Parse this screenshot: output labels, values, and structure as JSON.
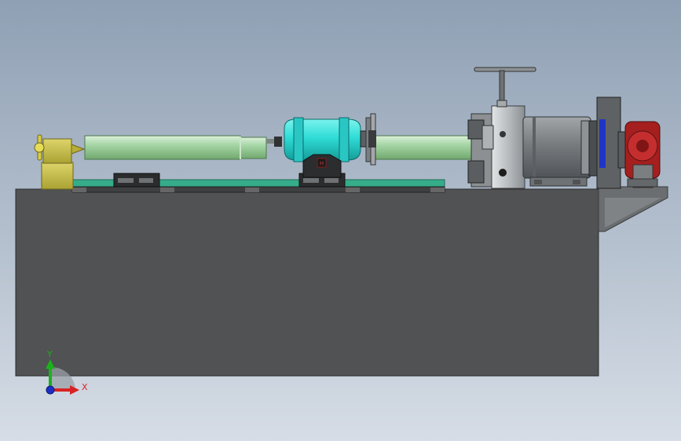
{
  "triad": {
    "y_label": "Y",
    "x_label": "X"
  },
  "colors": {
    "background_top": "#8fa0b4",
    "background_bottom": "#d6dde6",
    "base": "#505253",
    "pipe": "#a6d6a6",
    "carriage": "#2fdcd6",
    "tailstock": "#c7c04a",
    "motor": "#777b7e",
    "gearbox": "#b52626",
    "rail": "#35ad8a",
    "axis_y": "#19b319",
    "axis_x": "#d92222",
    "axis_z": "#1b2fc7"
  }
}
